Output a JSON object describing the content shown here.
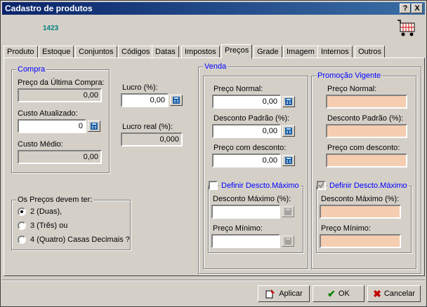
{
  "window": {
    "title": "Cadastro de produtos",
    "help_glyph": "?",
    "close_glyph": "X"
  },
  "header": {
    "product_code": "1423"
  },
  "tabs": [
    {
      "label": "Produto"
    },
    {
      "label": "Estoque"
    },
    {
      "label": "Conjuntos"
    },
    {
      "label": "Códigos"
    },
    {
      "label": "Datas"
    },
    {
      "label": "Impostos"
    },
    {
      "label": "Preços"
    },
    {
      "label": "Grade"
    },
    {
      "label": "Imagem"
    },
    {
      "label": "Internos"
    },
    {
      "label": "Outros"
    }
  ],
  "compra": {
    "title": "Compra",
    "ultima_label": "Preço da Última Compra:",
    "ultima_value": "0,00",
    "custo_atual_label": "Custo Atualizado:",
    "custo_atual_value": "0",
    "custo_medio_label": "Custo Médio:",
    "custo_medio_value": "0,00"
  },
  "lucro": {
    "label": "Lucro (%):",
    "value": "0,00",
    "real_label": "Lucro real (%):",
    "real_value": "0,000"
  },
  "decimais": {
    "title": "Os Preços devem ter:",
    "options": [
      "2 (Duas),",
      "3 (Três) ou",
      "4 (Quatro) Casas Decimais ?"
    ],
    "selected": 0
  },
  "venda": {
    "title": "Venda",
    "preco_normal_label": "Preço Normal:",
    "preco_normal_value": "0,00",
    "desconto_label": "Desconto Padrão (%):",
    "desconto_value": "0,00",
    "preco_desc_label": "Preço com desconto:",
    "preco_desc_value": "0,00",
    "definir_label": "Definir Descto.Máximo",
    "desc_max_label": "Desconto Máximo (%):",
    "desc_max_value": "",
    "preco_min_label": "Preço Mínimo:",
    "preco_min_value": ""
  },
  "promocao": {
    "title": "Promoção Vigente",
    "preco_normal_label": "Preço Normal:",
    "desconto_label": "Desconto Padrão (%):",
    "preco_desc_label": "Preço com desconto:",
    "definir_label": "Definir Descto.Máximo",
    "desc_max_label": "Desconto Máximo (%):",
    "preco_min_label": "Preço Mínimo:"
  },
  "buttons": {
    "aplicar": "Aplicar",
    "ok": "OK",
    "cancelar": "Cancelar"
  },
  "colors": {
    "peach": "#f5cdb0",
    "group_title": "#0000ff",
    "code": "#008080"
  }
}
